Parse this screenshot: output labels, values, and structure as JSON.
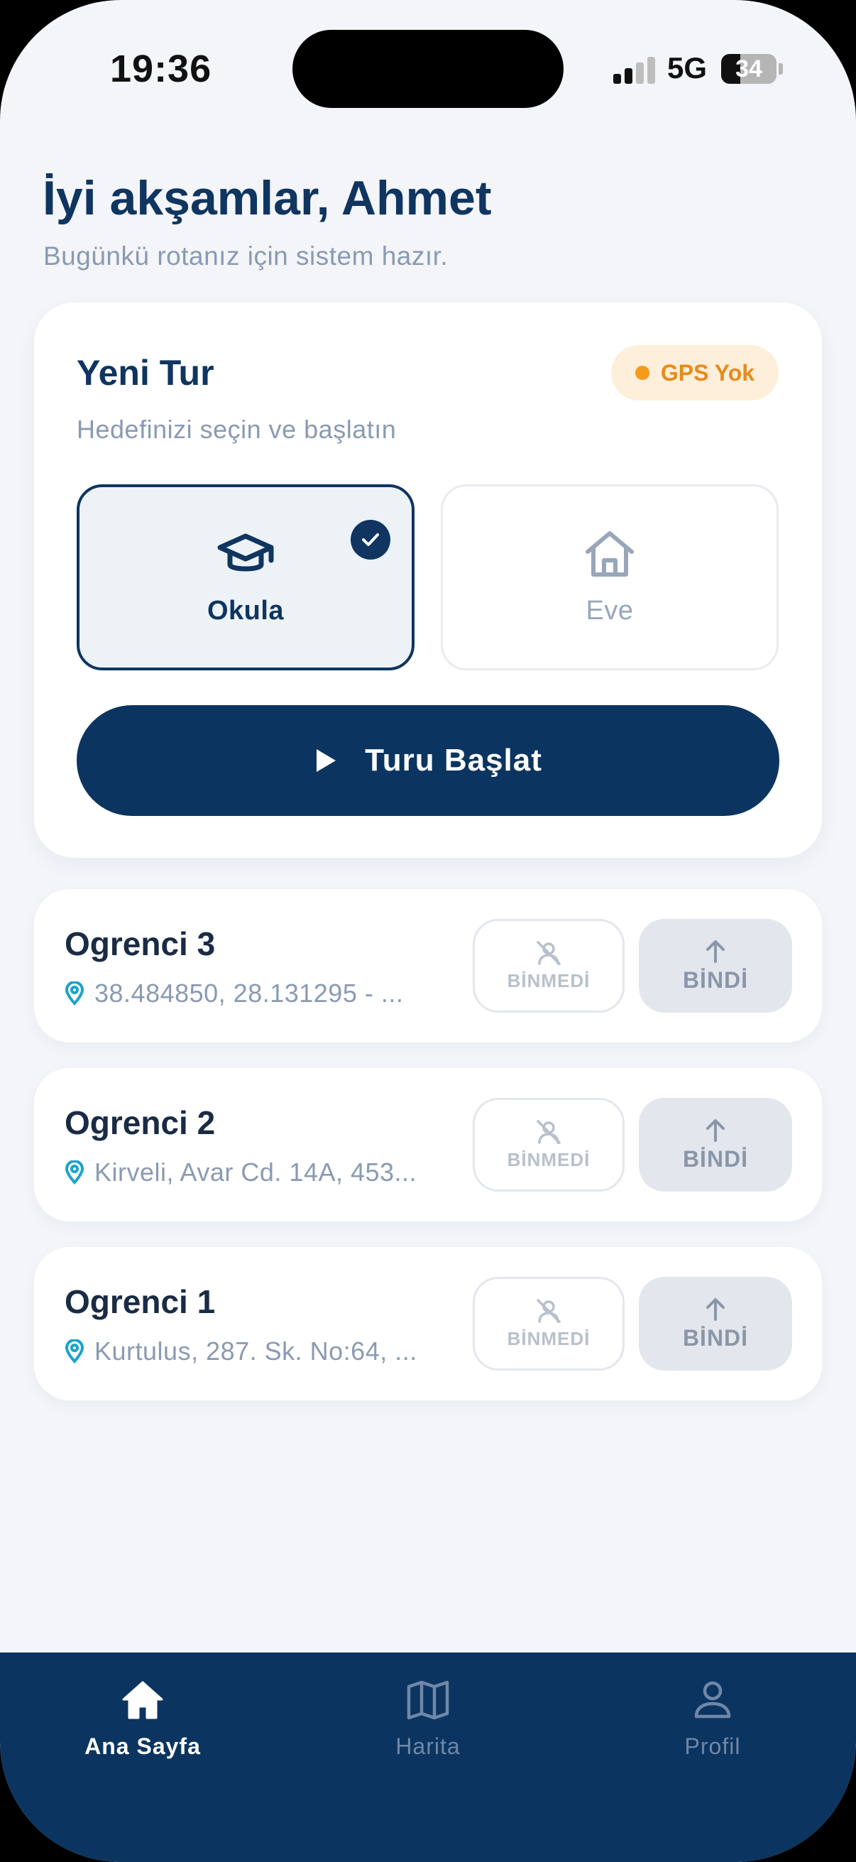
{
  "status_bar": {
    "time": "19:36",
    "network": "5G",
    "battery": 34
  },
  "header": {
    "greeting": "İyi akşamlar, Ahmet",
    "subtitle": "Bugünkü rotanız için sistem hazır."
  },
  "tour_card": {
    "title": "Yeni Tur",
    "subtitle": "Hedefinizi seçin ve başlatın",
    "gps_status": "GPS Yok",
    "destinations": [
      {
        "label": "Okula",
        "icon": "graduation-cap-icon",
        "selected": true
      },
      {
        "label": "Eve",
        "icon": "home-icon",
        "selected": false
      }
    ],
    "start_button": "Turu Başlat"
  },
  "students": [
    {
      "name": "Ogrenci 3",
      "address": "38.484850, 28.131295 - ...",
      "not_boarded_label": "BİNMEDİ",
      "boarded_label": "BİNDİ"
    },
    {
      "name": "Ogrenci 2",
      "address": "Kirveli, Avar Cd. 14A, 453...",
      "not_boarded_label": "BİNMEDİ",
      "boarded_label": "BİNDİ"
    },
    {
      "name": "Ogrenci 1",
      "address": "Kurtulus, 287. Sk. No:64, ...",
      "not_boarded_label": "BİNMEDİ",
      "boarded_label": "BİNDİ"
    }
  ],
  "bottom_nav": [
    {
      "label": "Ana Sayfa",
      "icon": "home-icon",
      "active": true
    },
    {
      "label": "Harita",
      "icon": "map-icon",
      "active": false
    },
    {
      "label": "Profil",
      "icon": "user-icon",
      "active": false
    }
  ],
  "colors": {
    "primary": "#0b3560",
    "background": "#f3f5f8",
    "warning": "#f59a1b",
    "muted": "#8a9ab2",
    "location_pin": "#1aa3c9"
  }
}
